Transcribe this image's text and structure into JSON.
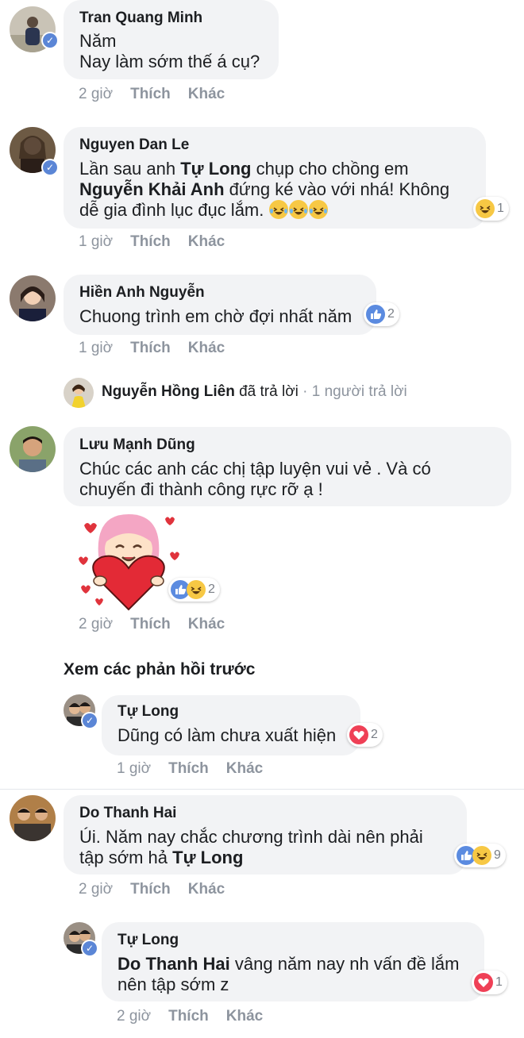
{
  "comments": [
    {
      "name": "Tran Quang Minh",
      "lines": [
        "Năm",
        "Nay làm sớm thế á cụ?"
      ],
      "time": "2 giờ",
      "like": "Thích",
      "more": "Khác",
      "avatar": "avatar-tran-quang-minh"
    },
    {
      "name": "Nguyen Dan Le",
      "line1_a": "Lần sau anh ",
      "line1_b": "Tự Long",
      "line1_c": " chụp cho chồng em",
      "line2_a": "Nguyễn Khải Anh",
      "line2_b": " đứng ké vào với nhá! Không",
      "line3": "dễ gia đình lục đục lắm. ",
      "reaction_count": "1",
      "time": "1 giờ",
      "like": "Thích",
      "more": "Khác"
    },
    {
      "name": "Hiền Anh Nguyễn",
      "lines": [
        "Chuong trình em chờ đợi nhất năm"
      ],
      "reaction_count": "2",
      "time": "1 giờ",
      "like": "Thích",
      "more": "Khác",
      "reply_summary": {
        "name": "Nguyễn Hồng Liên",
        "action": " đã trả lời",
        "sep": " · ",
        "count": "1 người trả lời"
      }
    },
    {
      "name": "Lưu Mạnh Dũng",
      "lines": [
        "Chúc các anh các chị tập luyện vui vẻ . Và có",
        "chuyến đi thành công rực rỡ ạ !"
      ],
      "reaction_count": "2",
      "sticker": "heart-girl-sticker",
      "time": "2 giờ",
      "like": "Thích",
      "more": "Khác"
    }
  ],
  "previous_replies_link": "Xem các phản hồi trước",
  "reply_tu_long_1": {
    "name": "Tự Long",
    "text": "Dũng có làm chưa xuất hiện",
    "reaction_count": "2",
    "time": "1 giờ",
    "like": "Thích",
    "more": "Khác"
  },
  "comment_do_thanh_hai": {
    "name": "Do Thanh Hai",
    "line1": "Úi. Năm nay chắc chương trình dài nên phải",
    "line2_a": "tập sớm hả ",
    "line2_b": "Tự Long",
    "reaction_count": "9",
    "time": "2 giờ",
    "like": "Thích",
    "more": "Khác"
  },
  "reply_tu_long_2": {
    "name": "Tự Long",
    "line1_a": "Do Thanh Hai",
    "line1_b": " vâng năm nay nh vấn đề lắm",
    "line2": "nên tập sớm z",
    "reaction_count": "1",
    "time": "2 giờ",
    "like": "Thích",
    "more": "Khác"
  },
  "colors": {
    "bubble": "#f2f3f5",
    "muted_text": "#8d949e",
    "like_blue": "#5b8be0",
    "love_red": "#ef4056",
    "haha_yellow": "#f7c844",
    "verified_blue": "#5b86d6"
  }
}
